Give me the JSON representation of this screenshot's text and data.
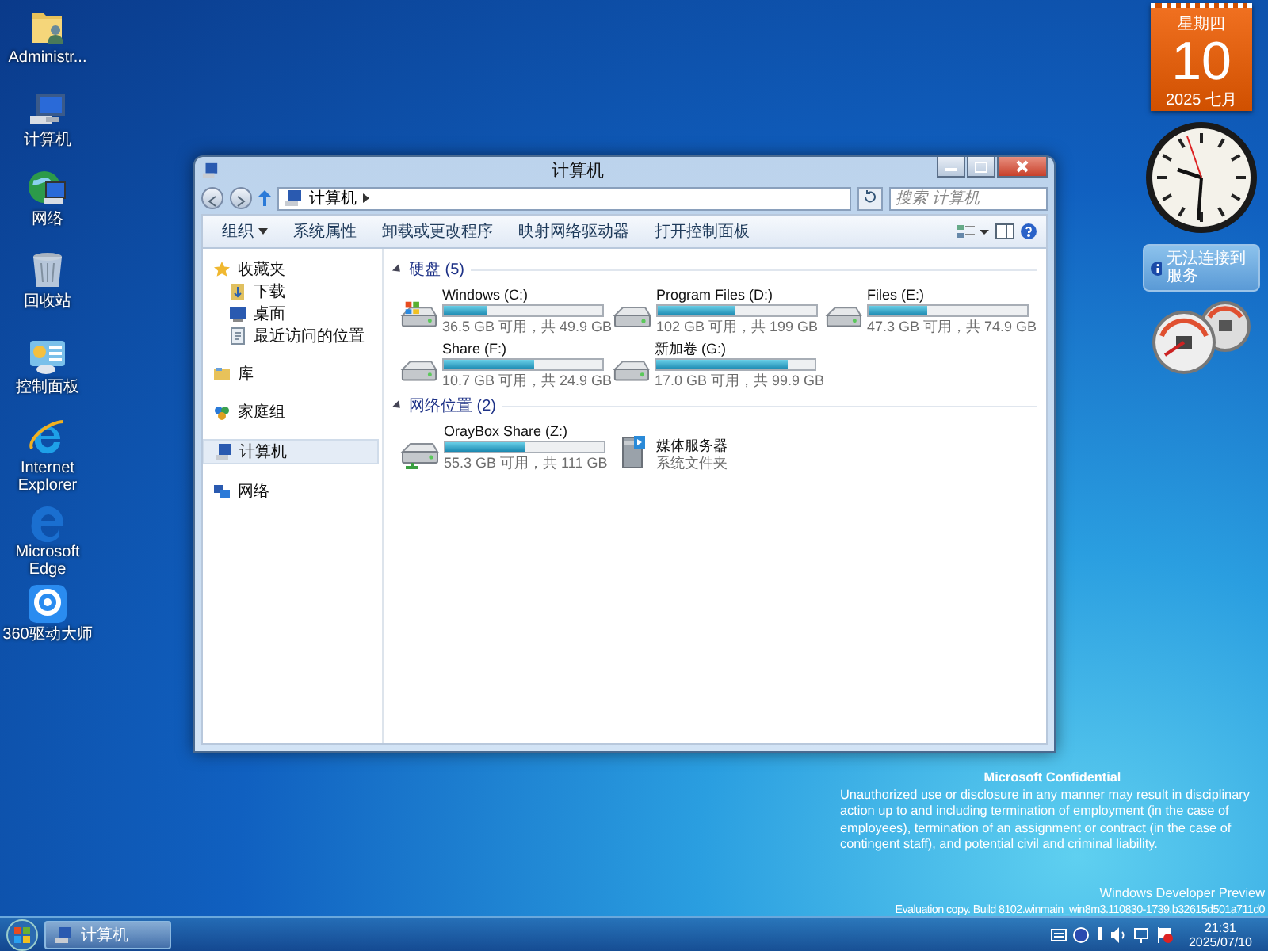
{
  "desktop_icons": [
    {
      "label": "Administr...",
      "kind": "user-folder"
    },
    {
      "label": "计算机",
      "kind": "computer"
    },
    {
      "label": "网络",
      "kind": "network"
    },
    {
      "label": "回收站",
      "kind": "recycle-bin"
    },
    {
      "label": "控制面板",
      "kind": "control-panel"
    },
    {
      "label": "Internet Explorer",
      "kind": "ie"
    },
    {
      "label": "Microsoft Edge",
      "kind": "edge"
    },
    {
      "label": "360驱动大师",
      "kind": "driver-tool"
    }
  ],
  "window": {
    "title": "计算机",
    "address": "计算机",
    "search": {
      "placeholder": "搜索 计算机"
    },
    "toolbar": [
      {
        "label": "组织",
        "kind": "menu"
      },
      {
        "label": "系统属性",
        "kind": "action"
      },
      {
        "label": "卸载或更改程序",
        "kind": "action"
      },
      {
        "label": "映射网络驱动器",
        "kind": "action"
      },
      {
        "label": "打开控制面板",
        "kind": "action"
      }
    ],
    "nav": [
      {
        "label": "收藏夹",
        "kind": "favorites",
        "selected": false,
        "children": [
          {
            "label": "下载",
            "kind": "downloads",
            "selected": false
          },
          {
            "label": "桌面",
            "kind": "desktop",
            "selected": false
          },
          {
            "label": "最近访问的位置",
            "kind": "recent",
            "selected": false
          }
        ]
      },
      {
        "label": "库",
        "kind": "libraries",
        "selected": false
      },
      {
        "label": "家庭组",
        "kind": "homegroup",
        "selected": false
      },
      {
        "label": "计算机",
        "kind": "computer",
        "selected": true
      },
      {
        "label": "网络",
        "kind": "network",
        "selected": false
      }
    ],
    "groups": [
      {
        "title": "硬盘 (5)",
        "items": [
          {
            "kind": "system-drive",
            "name": "Windows (C:)",
            "detail": "36.5 GB 可用，共 49.9 GB",
            "level": 0.27
          },
          {
            "kind": "drive",
            "name": "Program Files (D:)",
            "detail": "102 GB 可用，共 199 GB",
            "level": 0.49
          },
          {
            "kind": "drive",
            "name": "Files (E:)",
            "detail": "47.3 GB 可用，共 74.9 GB",
            "level": 0.37
          },
          {
            "kind": "drive",
            "name": "Share (F:)",
            "detail": "10.7 GB 可用，共 24.9 GB",
            "level": 0.57
          },
          {
            "kind": "drive",
            "name": "新加卷 (G:)",
            "detail": "17.0 GB 可用，共 99.9 GB",
            "level": 0.83
          }
        ]
      },
      {
        "title": "网络位置 (2)",
        "items": [
          {
            "kind": "network-drive",
            "name": "OrayBox Share (Z:)",
            "detail": "55.3 GB 可用，共 111 GB",
            "level": 0.5
          },
          {
            "kind": "media-folder",
            "name": "媒体服务器",
            "detail": "系统文件夹"
          }
        ]
      }
    ]
  },
  "gadgets": {
    "calendar": {
      "weekday": "星期四",
      "day": "10",
      "month": "2025 七月"
    },
    "network": {
      "message": "无法连接到服务"
    }
  },
  "notice": {
    "title": "Microsoft Confidential",
    "body": "Unauthorized use or disclosure in any manner may result in disciplinary action up to and including termination of employment (in the case of employees), termination of an assignment or contract (in the case of contingent staff), and potential civil and criminal liability.",
    "product": "Windows Developer Preview",
    "build": "Evaluation copy. Build 8102.winmain_win8m3.110830-1739.b32615d501a711d0"
  },
  "taskbar": {
    "buttons": [
      {
        "label": "计算机",
        "selected": true
      }
    ],
    "time": "21:31",
    "date": "2025/07/10"
  }
}
